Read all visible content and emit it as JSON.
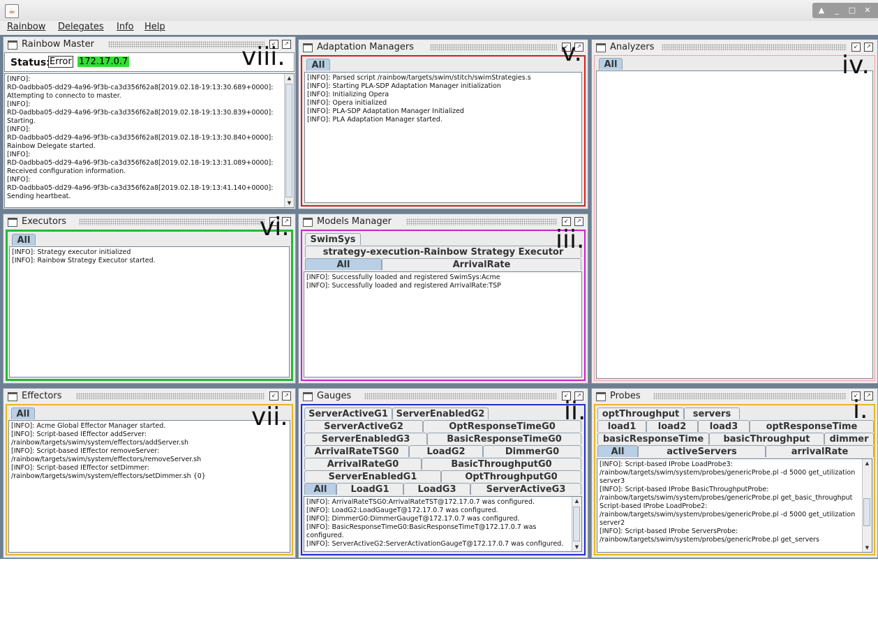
{
  "window": {
    "app_icon": "java-icon"
  },
  "menu": [
    "Rainbow",
    "Delegates",
    "Info",
    "Help"
  ],
  "colors": {
    "desktop": "#6d7f93",
    "status_ip_bg": "#33dd33",
    "selected_tab": "#b8cfe5"
  },
  "frames": {
    "master": {
      "title": "Rainbow Master",
      "status_label": "Status:",
      "status_value": "Error",
      "ip": "172.17.0.7",
      "annotation": "viii.",
      "log": [
        "[INFO]:",
        "RD-0adbba05-dd29-4a96-9f3b-ca3d356f62a8[2019.02.18-19:13:30.689+0000]:",
        "Attempting to connecto to master.",
        "[INFO]:",
        "RD-0adbba05-dd29-4a96-9f3b-ca3d356f62a8[2019.02.18-19:13:30.839+0000]:",
        "Starting.",
        "[INFO]:",
        "RD-0adbba05-dd29-4a96-9f3b-ca3d356f62a8[2019.02.18-19:13:30.840+0000]:",
        "Rainbow Delegate started.",
        "[INFO]:",
        "RD-0adbba05-dd29-4a96-9f3b-ca3d356f62a8[2019.02.18-19:13:31.089+0000]:",
        "Received configuration information.",
        "[INFO]:",
        "RD-0adbba05-dd29-4a96-9f3b-ca3d356f62a8[2019.02.18-19:13:41.140+0000]:",
        "Sending heartbeat."
      ]
    },
    "adaptation": {
      "title": "Adaptation Managers",
      "annotation": "v.",
      "tab": "All",
      "log": [
        "[INFO]: Parsed script /rainbow/targets/swim/stitch/swimStrategies.s",
        "[INFO]: Starting PLA-SDP Adaptation Manager initialization",
        "[INFO]: Initializing Opera",
        "[INFO]: Opera initialized",
        "[INFO]: PLA-SDP Adaptation Manager Initialized",
        "[INFO]: PLA Adaptation Manager started."
      ]
    },
    "analyzers": {
      "title": "Analyzers",
      "annotation": "iv.",
      "tab": "All"
    },
    "executors": {
      "title": "Executors",
      "annotation": "vi.",
      "tab": "All",
      "log": [
        "[INFO]: Strategy executor initialized",
        "[INFO]: Rainbow Strategy Executor started."
      ]
    },
    "models": {
      "title": "Models Manager",
      "annotation": "iii.",
      "tab_swimsys": "SwimSys",
      "tab_strategy": "strategy-execution-Rainbow Strategy Executor",
      "tab_all": "All",
      "tab_arrival": "ArrivalRate",
      "log": [
        "[INFO]: Successfully loaded and registered SwimSys:Acme",
        "[INFO]: Successfully loaded and registered ArrivalRate:TSP"
      ]
    },
    "effectors": {
      "title": "Effectors",
      "annotation": "vii.",
      "tab": "All",
      "log": [
        "[INFO]: Acme Global Effector Manager started.",
        "[INFO]: Script-based IEffector addServer:",
        "/rainbow/targets/swim/system/effectors/addServer.sh",
        "[INFO]: Script-based IEffector removeServer:",
        "/rainbow/targets/swim/system/effectors/removeServer.sh",
        "[INFO]: Script-based IEffector setDimmer:",
        "/rainbow/targets/swim/system/effectors/setDimmer.sh {0}"
      ]
    },
    "gauges": {
      "title": "Gauges",
      "annotation": "ii.",
      "tabs_r1": [
        "ServerActiveG1",
        "ServerEnabledG2"
      ],
      "tabs_r2": [
        "ServerActiveG2",
        "OptResponseTimeG0"
      ],
      "tabs_r3": [
        "ServerEnabledG3",
        "BasicResponseTimeG0"
      ],
      "tabs_r4": [
        "ArrivalRateTSG0",
        "LoadG2",
        "DimmerG0"
      ],
      "tabs_r5": [
        "ArrivalRateG0",
        "BasicThroughputG0"
      ],
      "tabs_r6": [
        "ServerEnabledG1",
        "OptThroughputG0"
      ],
      "tabs_r7": [
        "All",
        "LoadG1",
        "LoadG3",
        "ServerActiveG3"
      ],
      "log": [
        "[INFO]: ArrivalRateTSG0:ArrivalRateTST@172.17.0.7 was configured.",
        "[INFO]: LoadG2:LoadGaugeT@172.17.0.7 was configured.",
        "[INFO]: DimmerG0:DimmerGaugeT@172.17.0.7 was configured.",
        "[INFO]: BasicResponseTimeG0:BasicResponseTimeT@172.17.0.7 was",
        "configured.",
        "[INFO]: ServerActiveG2:ServerActivationGaugeT@172.17.0.7 was configured."
      ]
    },
    "probes": {
      "title": "Probes",
      "annotation": "i.",
      "tabs_r1": [
        "optThroughput",
        "servers"
      ],
      "tabs_r2": [
        "load1",
        "load2",
        "load3",
        "optResponseTime"
      ],
      "tabs_r3": [
        "basicResponseTime",
        "basicThroughput",
        "dimmer"
      ],
      "tabs_r4": [
        "All",
        "activeServers",
        "arrivalRate"
      ],
      "log": [
        "[INFO]: Script-based IProbe LoadProbe3:",
        "/rainbow/targets/swim/system/probes/genericProbe.pl -d 5000 get_utilization",
        "server3",
        "[INFO]: Script-based IProbe BasicThroughputProbe:",
        "/rainbow/targets/swim/system/probes/genericProbe.pl get_basic_throughput",
        " Script-based IProbe LoadProbe2:",
        "/rainbow/targets/swim/system/probes/genericProbe.pl -d 5000 get_utilization",
        "server2",
        "[INFO]: Script-based IProbe ServersProbe:",
        "/rainbow/targets/swim/system/probes/genericProbe.pl get_servers"
      ]
    }
  }
}
